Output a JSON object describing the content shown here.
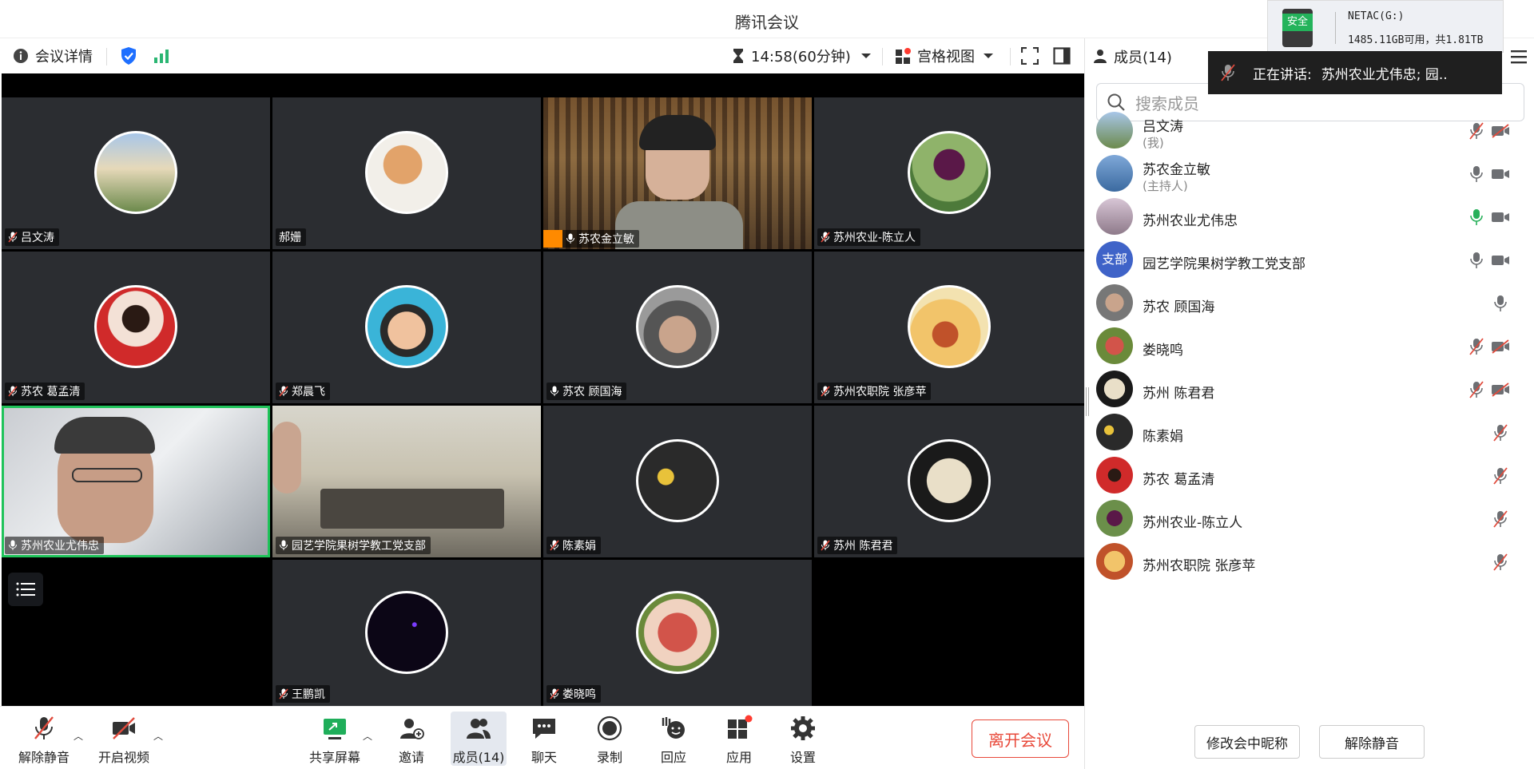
{
  "app": {
    "title": "腾讯会议"
  },
  "toolbar": {
    "meeting_info": "会议详情",
    "timer": "14:58(60分钟)",
    "view_mode": "宫格视图"
  },
  "tiles": [
    {
      "name": "吕文涛",
      "mic": "muted"
    },
    {
      "name": "郝姗",
      "mic": "none"
    },
    {
      "name": "苏农金立敏",
      "mic": "on",
      "host": true
    },
    {
      "name": "苏州农业-陈立人",
      "mic": "muted"
    },
    {
      "name": "苏农  葛孟清",
      "mic": "muted"
    },
    {
      "name": "郑晨飞",
      "mic": "muted"
    },
    {
      "name": "苏农    顾国海",
      "mic": "on"
    },
    {
      "name": "苏州农职院 张彦苹",
      "mic": "muted"
    },
    {
      "name": "苏州农业尤伟忠",
      "mic": "on"
    },
    {
      "name": "园艺学院果树学教工党支部",
      "mic": "on"
    },
    {
      "name": "陈素娟",
      "mic": "muted"
    },
    {
      "name": "苏州 陈君君",
      "mic": "muted"
    },
    {
      "name": "",
      "mic": "none"
    },
    {
      "name": "王鹏凯",
      "mic": "muted"
    },
    {
      "name": "娄晓鸣",
      "mic": "muted"
    },
    {
      "name": "",
      "mic": "none"
    }
  ],
  "bottombar": {
    "unmute": "解除静音",
    "start_video": "开启视频",
    "share": "共享屏幕",
    "invite": "邀请",
    "members": "成员(14)",
    "chat": "聊天",
    "record": "录制",
    "react": "回应",
    "apps": "应用",
    "settings": "设置",
    "leave": "离开会议"
  },
  "panel": {
    "title": "成员(14)",
    "search_placeholder": "搜索成员",
    "members": [
      {
        "name": "吕文涛",
        "sub": "(我)",
        "mic": "muted",
        "cam": "off"
      },
      {
        "name": "苏农金立敏",
        "sub": "(主持人)",
        "mic": "on",
        "cam": "on"
      },
      {
        "name": "苏州农业尤伟忠",
        "sub": "",
        "mic": "speaking",
        "cam": "on"
      },
      {
        "name": "园艺学院果树学教工党支部",
        "sub": "",
        "mic": "on",
        "cam": "on",
        "avatar_text": "支部"
      },
      {
        "name": "苏农    顾国海",
        "sub": "",
        "mic": "on",
        "cam": "none"
      },
      {
        "name": "娄晓鸣",
        "sub": "",
        "mic": "muted",
        "cam": "off"
      },
      {
        "name": "苏州 陈君君",
        "sub": "",
        "mic": "muted",
        "cam": "off"
      },
      {
        "name": "陈素娟",
        "sub": "",
        "mic": "muted",
        "cam": "none"
      },
      {
        "name": "苏农  葛孟清",
        "sub": "",
        "mic": "muted",
        "cam": "none"
      },
      {
        "name": "苏州农业-陈立人",
        "sub": "",
        "mic": "muted",
        "cam": "none"
      },
      {
        "name": "苏州农职院 张彦苹",
        "sub": "",
        "mic": "muted",
        "cam": "none"
      }
    ],
    "rename_button": "修改会中昵称",
    "unmute_all_button": "解除静音"
  },
  "overlay": {
    "security_badge": "安全",
    "drive_label": "NETAC(G:)",
    "drive_space": "1485.11GB可用，共1.81TB",
    "speaking_label": "正在讲话:",
    "speaking_names": "苏州农业尤伟忠; 园.."
  },
  "colors": {
    "accent": "#1e6fff",
    "active_border": "#1fc35a",
    "leave": "#e8493a",
    "muted": "#e04a3c"
  }
}
